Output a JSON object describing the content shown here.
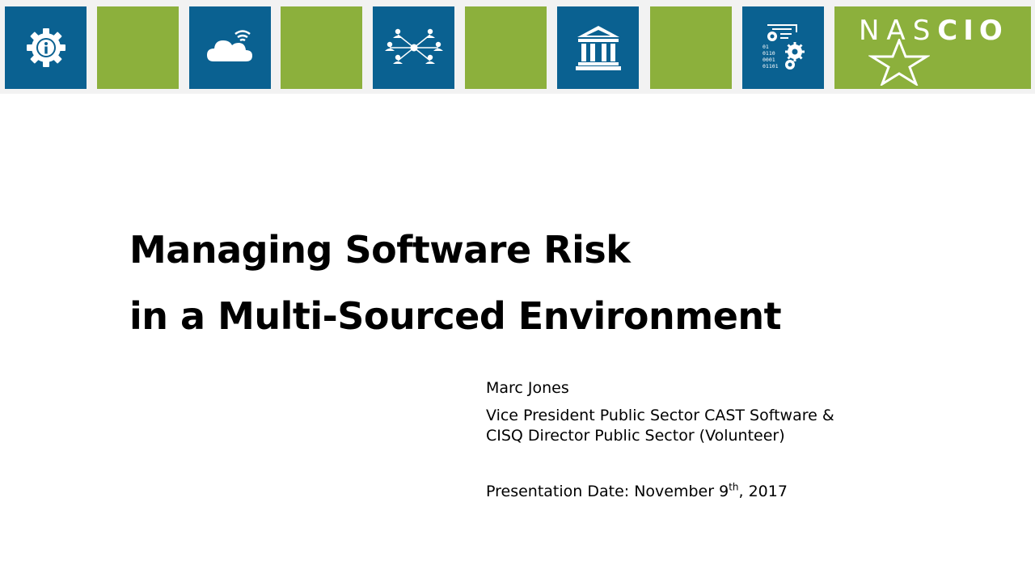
{
  "banner": {
    "tiles": [
      {
        "color": "#0a6191",
        "icon": "gear-info-icon"
      },
      {
        "color": "#8cb03c",
        "icon": ""
      },
      {
        "color": "#0a6191",
        "icon": "cloud-wifi-icon"
      },
      {
        "color": "#8cb03c",
        "icon": ""
      },
      {
        "color": "#0a6191",
        "icon": "network-people-icon"
      },
      {
        "color": "#8cb03c",
        "icon": ""
      },
      {
        "color": "#0a6191",
        "icon": "government-building-icon"
      },
      {
        "color": "#8cb03c",
        "icon": ""
      },
      {
        "color": "#0a6191",
        "icon": "binary-gears-icon"
      }
    ],
    "logo": {
      "text_nas": "NAS",
      "text_cio": "CIO",
      "icon": "star-outline-icon",
      "color": "#8cb03c"
    },
    "binary_text": [
      "01",
      "0110",
      "0001",
      "01101"
    ]
  },
  "title": {
    "line1": "Managing Software Risk",
    "line2": "in a Multi-Sourced Environment"
  },
  "presenter": {
    "name": "Marc Jones",
    "role_line1": "Vice President Public Sector CAST Software &",
    "role_line2": "CISQ Director Public Sector (Volunteer)",
    "date_prefix": "Presentation Date: November 9",
    "date_suffix": "th",
    "date_year": ", 2017"
  },
  "colors": {
    "blue": "#0a6191",
    "green": "#8cb03c",
    "banner_bg": "#f2f2f2"
  }
}
